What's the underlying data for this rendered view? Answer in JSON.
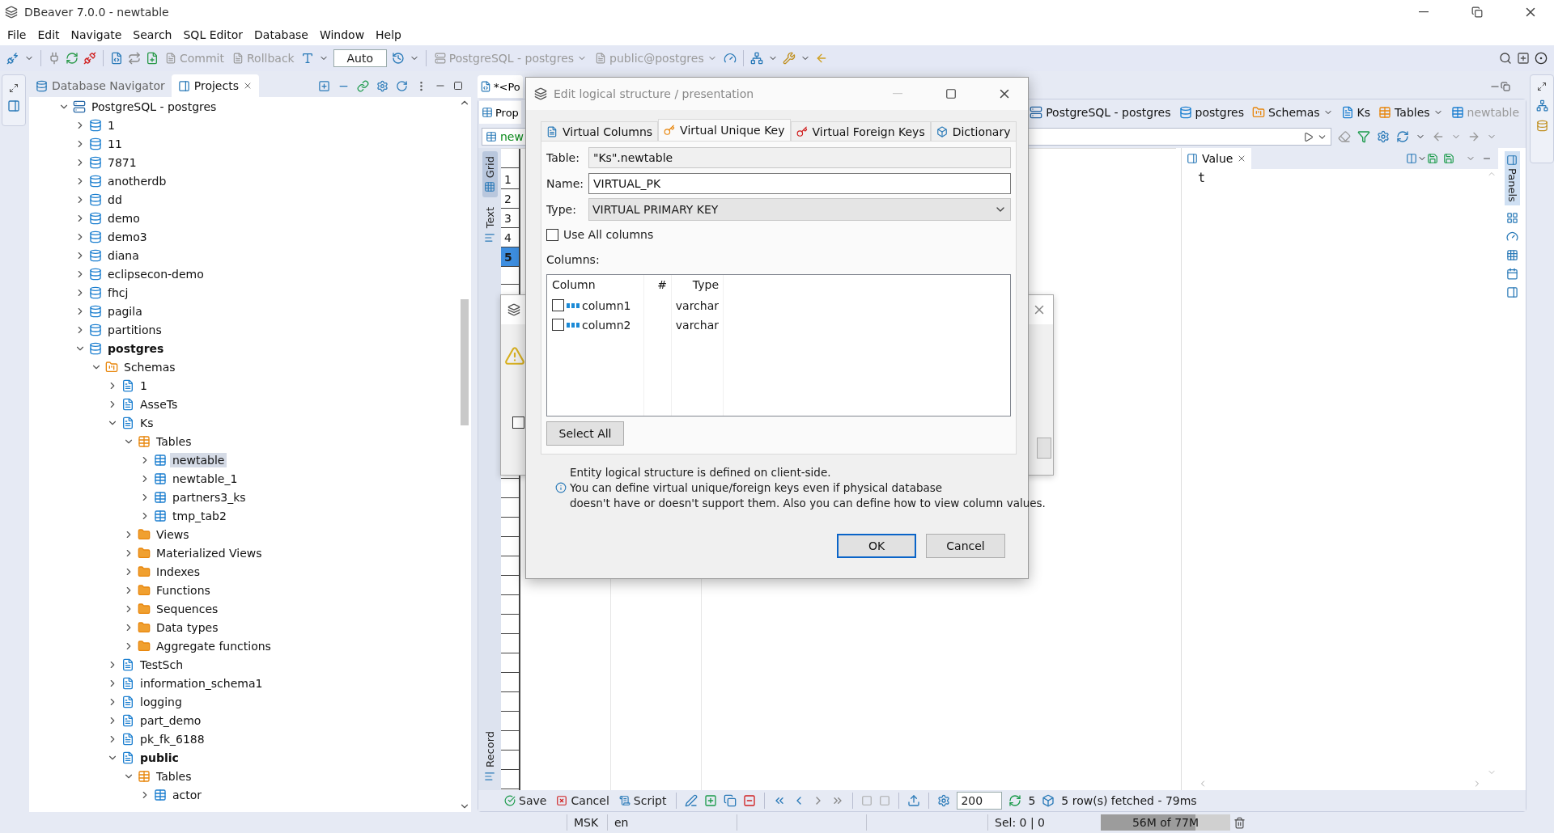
{
  "window": {
    "title": "DBeaver 7.0.0 - newtable"
  },
  "menu": [
    "File",
    "Edit",
    "Navigate",
    "Search",
    "SQL Editor",
    "Database",
    "Window",
    "Help"
  ],
  "toolbar": {
    "commit": {
      "label": "Commit",
      "disabled": true
    },
    "rollback": {
      "label": "Rollback",
      "disabled": true
    },
    "mode": "Auto",
    "connection": "PostgreSQL - postgres",
    "schema": "public@postgres"
  },
  "navigator": {
    "tabs": [
      {
        "label": "Database Navigator",
        "selected": false,
        "closable": false
      },
      {
        "label": "Projects",
        "selected": true,
        "closable": true
      }
    ],
    "tree": [
      {
        "label": "PostgreSQL - postgres",
        "kind": "connection",
        "expanded": true,
        "selected": false,
        "active": false,
        "children": [
          {
            "label": "1",
            "kind": "database",
            "expanded": false,
            "selected": false,
            "active": false
          },
          {
            "label": "11",
            "kind": "database",
            "expanded": false,
            "selected": false,
            "active": false
          },
          {
            "label": "7871",
            "kind": "database",
            "expanded": false,
            "selected": false,
            "active": false
          },
          {
            "label": "anotherdb",
            "kind": "database",
            "expanded": false,
            "selected": false,
            "active": false
          },
          {
            "label": "dd",
            "kind": "database",
            "expanded": false,
            "selected": false,
            "active": false
          },
          {
            "label": "demo",
            "kind": "database",
            "expanded": false,
            "selected": false,
            "active": false
          },
          {
            "label": "demo3",
            "kind": "database",
            "expanded": false,
            "selected": false,
            "active": false
          },
          {
            "label": "diana",
            "kind": "database",
            "expanded": false,
            "selected": false,
            "active": false
          },
          {
            "label": "eclipsecon-demo",
            "kind": "database",
            "expanded": false,
            "selected": false,
            "active": false
          },
          {
            "label": "fhcj",
            "kind": "database",
            "expanded": false,
            "selected": false,
            "active": false
          },
          {
            "label": "pagila",
            "kind": "database",
            "expanded": false,
            "selected": false,
            "active": false
          },
          {
            "label": "partitions",
            "kind": "database",
            "expanded": false,
            "selected": false,
            "active": false
          },
          {
            "label": "postgres",
            "kind": "database",
            "expanded": true,
            "selected": false,
            "active": true,
            "children": [
              {
                "label": "Schemas",
                "kind": "schemas",
                "expanded": true,
                "selected": false,
                "active": false,
                "children": [
                  {
                    "label": "1",
                    "kind": "schema",
                    "expanded": false,
                    "selected": false,
                    "active": false
                  },
                  {
                    "label": "AsseTs",
                    "kind": "schema",
                    "expanded": false,
                    "selected": false,
                    "active": false
                  },
                  {
                    "label": "Ks",
                    "kind": "schema",
                    "expanded": true,
                    "selected": false,
                    "active": false,
                    "children": [
                      {
                        "label": "Tables",
                        "kind": "tables",
                        "expanded": true,
                        "selected": false,
                        "active": false,
                        "children": [
                          {
                            "label": "newtable",
                            "kind": "table",
                            "expanded": false,
                            "selected": true,
                            "active": false
                          },
                          {
                            "label": "newtable_1",
                            "kind": "table",
                            "expanded": false,
                            "selected": false,
                            "active": false
                          },
                          {
                            "label": "partners3_ks",
                            "kind": "table",
                            "expanded": false,
                            "selected": false,
                            "active": false
                          },
                          {
                            "label": "tmp_tab2",
                            "kind": "table",
                            "expanded": false,
                            "selected": false,
                            "active": false
                          }
                        ]
                      },
                      {
                        "label": "Views",
                        "kind": "folder",
                        "expanded": false,
                        "selected": false,
                        "active": false
                      },
                      {
                        "label": "Materialized Views",
                        "kind": "folder",
                        "expanded": false,
                        "selected": false,
                        "active": false
                      },
                      {
                        "label": "Indexes",
                        "kind": "folder",
                        "expanded": false,
                        "selected": false,
                        "active": false
                      },
                      {
                        "label": "Functions",
                        "kind": "folder",
                        "expanded": false,
                        "selected": false,
                        "active": false
                      },
                      {
                        "label": "Sequences",
                        "kind": "folder",
                        "expanded": false,
                        "selected": false,
                        "active": false
                      },
                      {
                        "label": "Data types",
                        "kind": "folder",
                        "expanded": false,
                        "selected": false,
                        "active": false
                      },
                      {
                        "label": "Aggregate functions",
                        "kind": "folder",
                        "expanded": false,
                        "selected": false,
                        "active": false
                      }
                    ]
                  },
                  {
                    "label": "TestSch",
                    "kind": "schema",
                    "expanded": false,
                    "selected": false,
                    "active": false
                  },
                  {
                    "label": "information_schema1",
                    "kind": "schema",
                    "expanded": false,
                    "selected": false,
                    "active": false
                  },
                  {
                    "label": "logging",
                    "kind": "schema",
                    "expanded": false,
                    "selected": false,
                    "active": false
                  },
                  {
                    "label": "part_demo",
                    "kind": "schema",
                    "expanded": false,
                    "selected": false,
                    "active": false
                  },
                  {
                    "label": "pk_fk_6188",
                    "kind": "schema",
                    "expanded": false,
                    "selected": false,
                    "active": false
                  },
                  {
                    "label": "public",
                    "kind": "schema",
                    "expanded": true,
                    "selected": false,
                    "active": true,
                    "children": [
                      {
                        "label": "Tables",
                        "kind": "tables",
                        "expanded": true,
                        "selected": false,
                        "active": false,
                        "children": [
                          {
                            "label": "actor",
                            "kind": "table",
                            "expanded": false,
                            "selected": false,
                            "active": false
                          }
                        ]
                      }
                    ]
                  }
                ]
              }
            ]
          }
        ]
      }
    ]
  },
  "editor": {
    "tab": "*<Po",
    "subtab": "Prop",
    "filter_object": "new",
    "breadcrumbs": [
      {
        "label": "PostgreSQL - postgres",
        "kind": "connection",
        "disabled": false,
        "dropdown": false
      },
      {
        "label": "postgres",
        "kind": "database",
        "disabled": false,
        "dropdown": false
      },
      {
        "label": "Schemas",
        "kind": "schemas",
        "disabled": false,
        "dropdown": true
      },
      {
        "label": "Ks",
        "kind": "schema",
        "disabled": false,
        "dropdown": false
      },
      {
        "label": "Tables",
        "kind": "tables",
        "disabled": false,
        "dropdown": true
      },
      {
        "label": "newtable",
        "kind": "table",
        "disabled": true,
        "dropdown": false
      }
    ],
    "view_tabs": [
      {
        "label": "Grid",
        "selected": true
      },
      {
        "label": "Text",
        "selected": false
      },
      {
        "label": "Record",
        "selected": false
      }
    ],
    "rows": [
      {
        "label": "1",
        "selected": false
      },
      {
        "label": "2",
        "selected": false
      },
      {
        "label": "3",
        "selected": false
      },
      {
        "label": "4",
        "selected": false
      },
      {
        "label": "5",
        "selected": true
      }
    ],
    "value_panel": {
      "title": "Value",
      "content": "t"
    },
    "panels_label": "Panels"
  },
  "results_toolbar": {
    "save": "Save",
    "cancel": "Cancel",
    "script": "Script",
    "fetch_size": "200",
    "row_count": "5",
    "status": "5 row(s) fetched - 79ms"
  },
  "status_bar": {
    "timezone": "MSK",
    "locale": "en",
    "selection": "Sel: 0 | 0",
    "memory": {
      "label": "56M of 77M",
      "level": 0.73
    }
  },
  "background_dialog": {
    "checked": false
  },
  "dialog": {
    "title": "Edit logical structure / presentation",
    "tabs": [
      {
        "label": "Virtual Columns",
        "selected": false
      },
      {
        "label": "Virtual Unique Key",
        "selected": true
      },
      {
        "label": "Virtual Foreign Keys",
        "selected": false
      },
      {
        "label": "Dictionary",
        "selected": false
      }
    ],
    "table_label": "Table:",
    "table_value": "\"Ks\".newtable",
    "name_label": "Name:",
    "name_value": "VIRTUAL_PK",
    "type_label": "Type:",
    "type_value": "VIRTUAL PRIMARY KEY",
    "use_all": {
      "label": "Use All columns",
      "checked": false
    },
    "columns_label": "Columns:",
    "columns_header": [
      "Column",
      "#",
      "Type"
    ],
    "columns": [
      {
        "name": "column1",
        "type": "varchar",
        "checked": false
      },
      {
        "name": "column2",
        "type": "varchar",
        "checked": false
      }
    ],
    "select_all": "Select All",
    "info": [
      "Entity logical structure is defined on client-side.",
      "You can define virtual unique/foreign keys even if physical database",
      "doesn't have or doesn't support them. Also you can define how to view column values."
    ],
    "buttons": [
      {
        "label": "OK",
        "default": true
      },
      {
        "label": "Cancel",
        "default": false
      }
    ]
  }
}
